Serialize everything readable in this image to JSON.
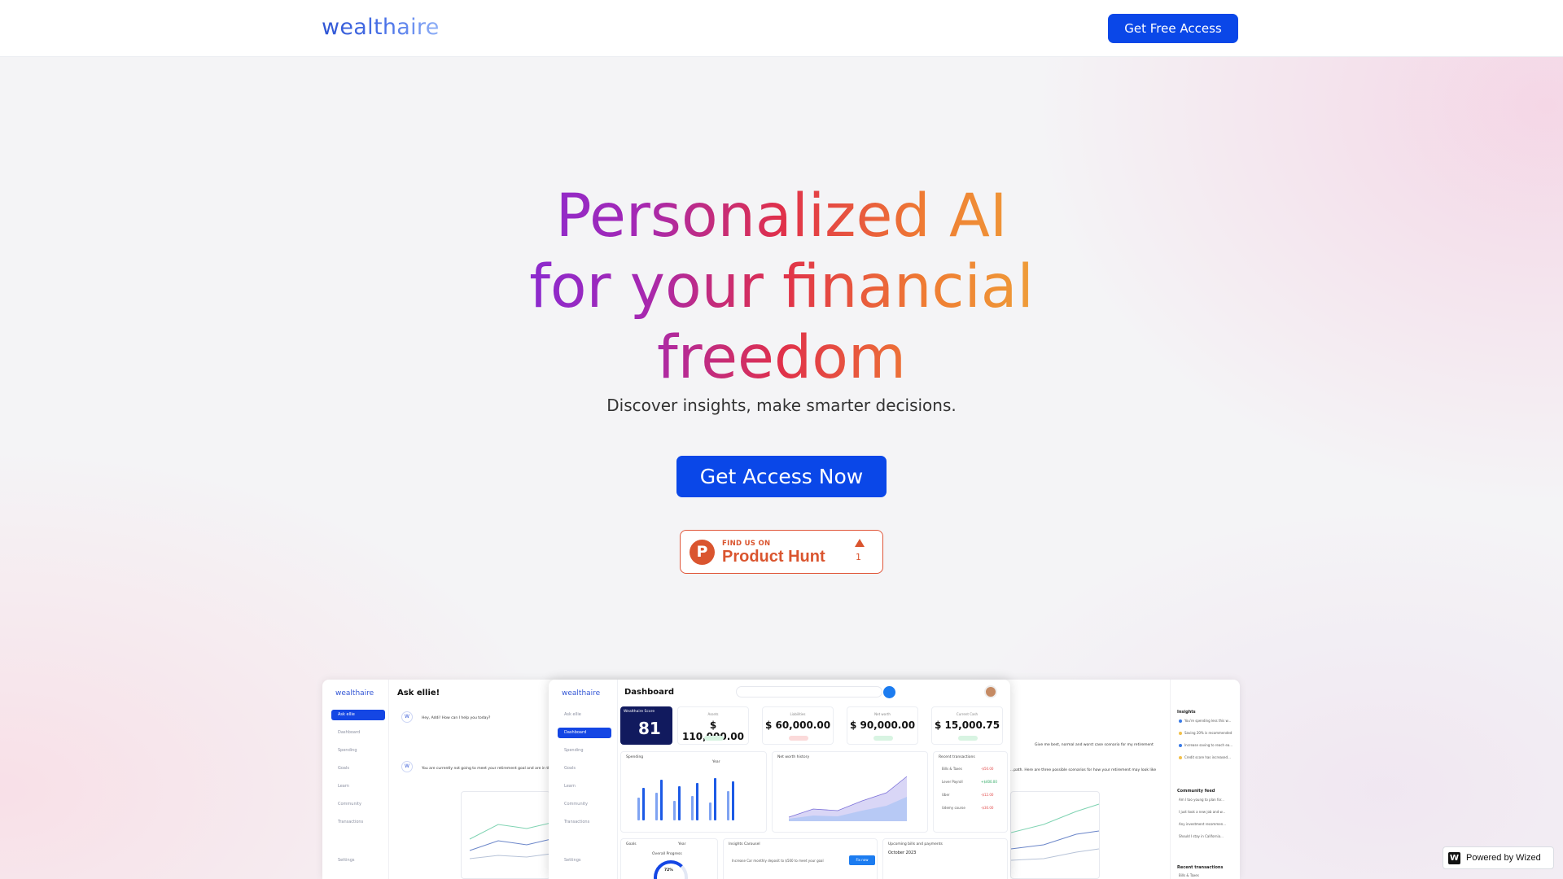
{
  "header": {
    "logo": "wealthaire",
    "cta_label": "Get Free Access"
  },
  "hero": {
    "title_lines": [
      "Personalized AI",
      "for your financial",
      "freedom"
    ],
    "subtitle": "Discover insights, make smarter decisions.",
    "cta_label": "Get Access Now"
  },
  "product_hunt": {
    "small_label": "FIND US ON",
    "name": "Product Hunt",
    "upvotes": "1"
  },
  "preview_back": {
    "logo": "wealthaire",
    "title": "Ask ellie!",
    "nav": [
      "Ask ellie",
      "Dashboard",
      "Spending",
      "Goals",
      "Learn",
      "Community",
      "Transactions",
      "Settings"
    ],
    "chat_greeting": "Hey, Addi! How can I help you today?",
    "chat_reply": "You are currently not going to meet your retirement goal and are in the worst ca...",
    "right_user_message": "Give me best, normal and worst case scenario for my retirement",
    "right_reply": "...path. Here are three possible scenarios for how your retirement may look like",
    "insights_title": "Insights",
    "insights": [
      "You're spending less this w...",
      "Saving 20% is recommended",
      "Increase saving to reach ea...",
      "Credit score has increased..."
    ],
    "community_title": "Community feed",
    "community": [
      "Am I too young to plan for...",
      "I just took a new job and w...",
      "Any investment recommen...",
      "Should I stay in California..."
    ],
    "recent_title": "Recent transactions",
    "recent_item": "Bills & Taxes",
    "recent_amount": "-$50.00"
  },
  "preview_front": {
    "logo": "wealthaire",
    "title": "Dashboard",
    "nav": [
      "Ask ellie",
      "Dashboard",
      "Spending",
      "Goals",
      "Learn",
      "Community",
      "Transactions",
      "Settings"
    ],
    "score_label": "Wealthaire Score",
    "score_value": "81",
    "stats": [
      {
        "label": "Assets",
        "value": "$ 110,000.00"
      },
      {
        "label": "Liabilities",
        "value": "$ 60,000.00"
      },
      {
        "label": "Net worth",
        "value": "$ 90,000.00"
      },
      {
        "label": "Current Cash",
        "value": "$ 15,000.75"
      }
    ],
    "spending_title": "Spending",
    "spending_period": "Year",
    "networth_title": "Net worth history",
    "transactions_title": "Recent transactions",
    "transactions": [
      {
        "name": "Bills & Taxes",
        "amount": "-$50.00"
      },
      {
        "name": "Lever Payroll",
        "amount": "+$400.00"
      },
      {
        "name": "Uber",
        "amount": "-$12.00"
      },
      {
        "name": "Udemy course",
        "amount": "-$30.00"
      }
    ],
    "goals_title": "Goals",
    "goals_period": "Year",
    "overall_progress_label": "Overall Progress",
    "overall_progress": "72%",
    "insights_title": "Insights Carousel",
    "insights_text": "Increase Car monthly deposit to $500 to meet your goal",
    "insights_button": "Fix now",
    "payments_title": "Upcoming bills and payments",
    "calendar_month": "October 2023"
  },
  "badge": {
    "wized_label": "Powered by Wized"
  },
  "colors": {
    "primary": "#0a47e8",
    "product_hunt": "#da552f"
  }
}
